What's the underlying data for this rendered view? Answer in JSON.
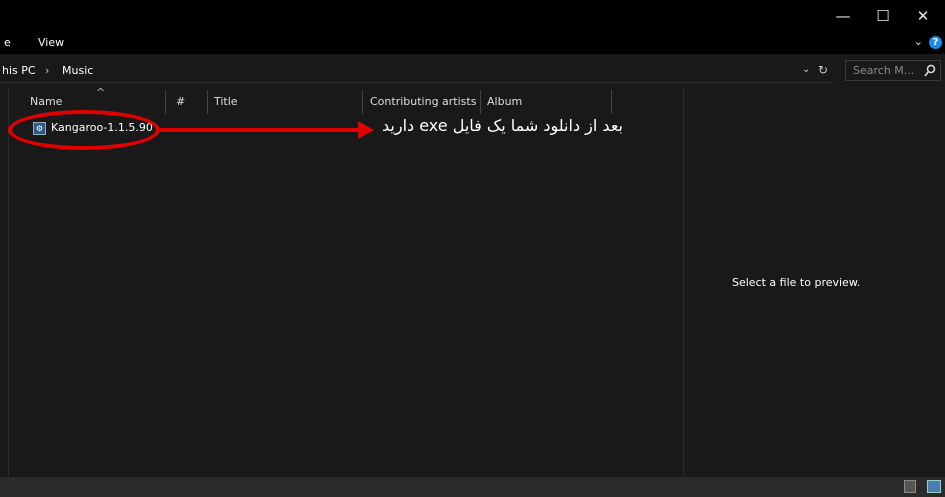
{
  "window": {
    "minimize_glyph": "—",
    "maximize_glyph": "☐",
    "close_glyph": "✕"
  },
  "ribbon": {
    "file_tab_fragment": "e",
    "view_tab": "View",
    "expand_glyph": "⌄",
    "help_glyph": "?"
  },
  "address": {
    "crumb_root": "his PC",
    "separator": "›",
    "crumb_current": "Music",
    "dropdown_glyph": "⌄",
    "refresh_glyph": "↻"
  },
  "search": {
    "placeholder": "Search M...",
    "icon": "search-icon"
  },
  "columns": {
    "name": "Name",
    "number": "#",
    "title": "Title",
    "contributing_artists": "Contributing artists",
    "album": "Album",
    "sort_glyph": "^"
  },
  "files": [
    {
      "name": "Kangaroo-1.1.5.90",
      "icon": "installer-icon"
    }
  ],
  "annotation": {
    "text": "بعد از دانلود شما یک فایل exe دارید",
    "color": "#e00000"
  },
  "preview": {
    "message": "Select a file to preview."
  }
}
